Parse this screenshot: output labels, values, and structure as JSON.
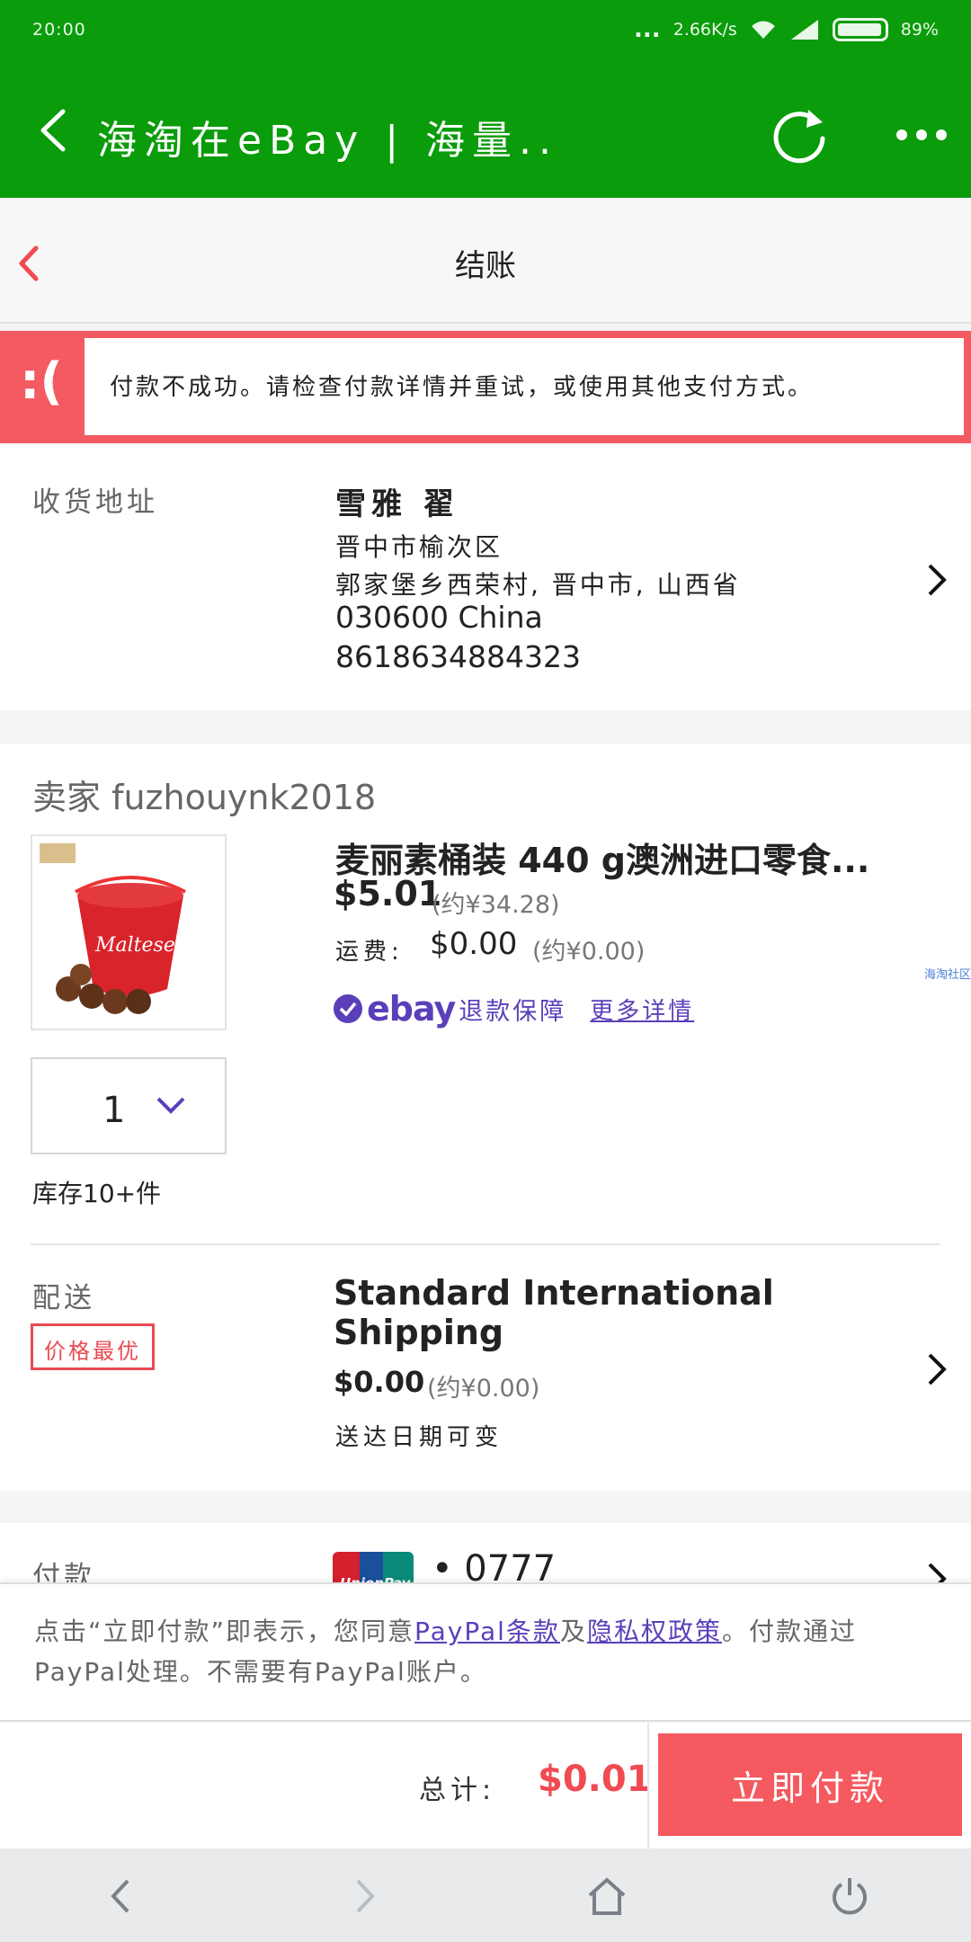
{
  "status_bar": {
    "time": "20:00",
    "net_speed": "2.66K/s",
    "battery_pct": "89%",
    "dots": "..."
  },
  "app_bar": {
    "title": "海淘在eBay | 海量.."
  },
  "checkout": {
    "title": "结账"
  },
  "alert": {
    "face": ":(",
    "message": "付款不成功。请检查付款详情并重试，或使用其他支付方式。"
  },
  "address": {
    "label": "收货地址",
    "name": "雪雅 翟",
    "line1": "晋中市榆次区",
    "line2": "郭家堡乡西荣村, 晋中市, 山西省",
    "line3": "030600 China",
    "phone": "8618634884323"
  },
  "item": {
    "seller": "卖家 fuzhouynk2018",
    "title": "麦丽素桶装 440 g澳洲进口零食...",
    "price": "$5.01",
    "price_cny": "(约¥34.28)",
    "shipping_label": "运费:",
    "shipping_price": "$0.00",
    "shipping_cny": "(约¥0.00)",
    "guarantee_brand": "ebay",
    "guarantee_text": "退款保障",
    "guarantee_link": "更多详情",
    "side_link": "海淘社区",
    "quantity": "1",
    "stock": "库存10+件"
  },
  "delivery": {
    "label": "配送",
    "badge": "价格最优",
    "method": "Standard International Shipping",
    "price": "$0.00",
    "price_cny": "(约¥0.00)",
    "date_note": "送达日期可变"
  },
  "payment": {
    "label": "付款",
    "card_brand": "UnionPay",
    "card_mask": "• 0777"
  },
  "terms": {
    "pre": "点击“立即付款”即表示，您同意",
    "link1": "PayPal条款",
    "mid": "及",
    "link2": "隐私权政策",
    "post": "。付款通过PayPal处理。不需要有PayPal账户。"
  },
  "pay_bar": {
    "total_label": "总计:",
    "total": "$0.01",
    "button": "立即付款"
  },
  "colors": {
    "app_green": "#0a9c0a",
    "alert_red": "#f35a62",
    "ebay_purple": "#5a3fb9",
    "pay_button": "#f45a5f"
  }
}
